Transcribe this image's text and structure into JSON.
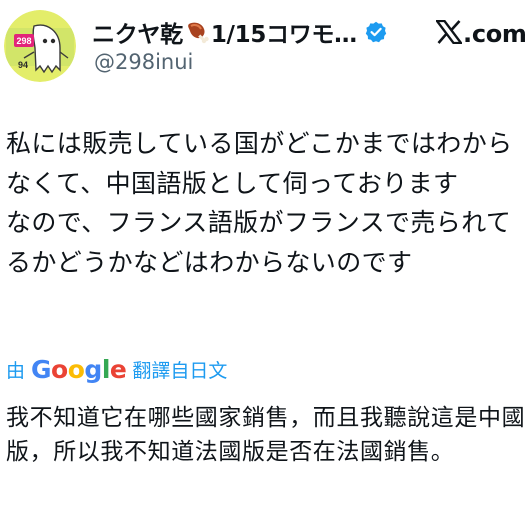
{
  "author": {
    "display_name": "ニクヤ乾",
    "name_suffix": "1/15コワモ…",
    "handle": "@298inui",
    "avatar_label": "298",
    "avatar_label_2": "94"
  },
  "icons": {
    "meat": "meat-on-bone-icon",
    "verified": "verified-badge-icon",
    "x_logo": "x-logo-icon"
  },
  "site": {
    "domain": ".com"
  },
  "tweet": {
    "text": "私には販売している国がどこかまではわからなくて、中国語版として伺っております\nなので、フランス語版がフランスで売られてるかどうかなどはわからないのです"
  },
  "translation": {
    "by_label": "由",
    "google_letters": [
      "G",
      "o",
      "o",
      "g",
      "l",
      "e"
    ],
    "translated_from": "翻譯自日文",
    "text": "我不知道它在哪些國家銷售，而且我聽說這是中國版，所以我不知道法國版是否在法國銷售。"
  },
  "colors": {
    "link_blue": "#1d9bf0",
    "verified_blue": "#1d9bf0",
    "handle_gray": "#536471",
    "google": [
      "#4285F4",
      "#EA4335",
      "#FBBC05",
      "#4285F4",
      "#34A853",
      "#EA4335"
    ]
  }
}
